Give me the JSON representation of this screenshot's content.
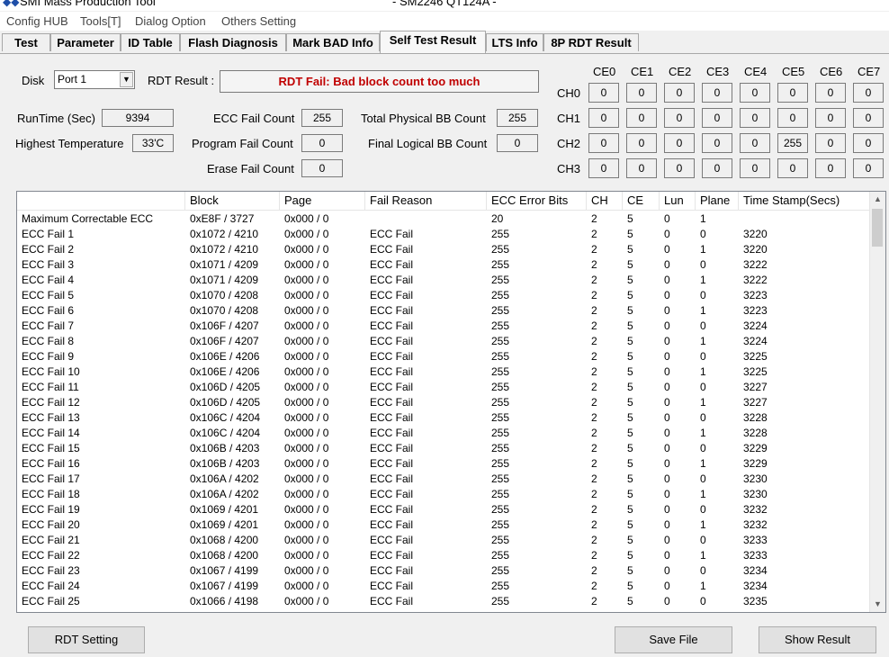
{
  "window": {
    "title_left": "SMI Mass Production Tool",
    "title_right": "- SM2246 QT124A -"
  },
  "menu": [
    "Config HUB",
    "Tools[T]",
    "Dialog Option",
    "Others Setting"
  ],
  "tabs": [
    "Test",
    "Parameter",
    "ID Table",
    "Flash Diagnosis",
    "Mark BAD Info",
    "Self Test Result",
    "LTS Info",
    "8P RDT Result"
  ],
  "active_tab": "Self Test Result",
  "disk": {
    "label": "Disk",
    "selected": "Port 1"
  },
  "rdt_result": {
    "label": "RDT Result :",
    "value": "RDT Fail:  Bad block count too much",
    "color": "#c00000"
  },
  "stats": {
    "runtime_label": "RunTime (Sec)",
    "runtime_value": "9394",
    "temp_label": "Highest Temperature",
    "temp_value": "33'C",
    "ecc_fail_label": "ECC Fail Count",
    "ecc_fail_value": "255",
    "program_fail_label": "Program Fail Count",
    "program_fail_value": "0",
    "erase_fail_label": "Erase Fail Count",
    "erase_fail_value": "0",
    "total_bb_label": "Total Physical BB Count",
    "total_bb_value": "255",
    "final_bb_label": "Final Logical BB Count",
    "final_bb_value": "0"
  },
  "grid": {
    "ce_headers": [
      "CE0",
      "CE1",
      "CE2",
      "CE3",
      "CE4",
      "CE5",
      "CE6",
      "CE7"
    ],
    "ch_headers": [
      "CH0",
      "CH1",
      "CH2",
      "CH3"
    ],
    "values": [
      [
        "0",
        "0",
        "0",
        "0",
        "0",
        "0",
        "0",
        "0"
      ],
      [
        "0",
        "0",
        "0",
        "0",
        "0",
        "0",
        "0",
        "0"
      ],
      [
        "0",
        "0",
        "0",
        "0",
        "0",
        "255",
        "0",
        "0"
      ],
      [
        "0",
        "0",
        "0",
        "0",
        "0",
        "0",
        "0",
        "0"
      ]
    ]
  },
  "table": {
    "columns": [
      "",
      "Block",
      "Page",
      "Fail Reason",
      "ECC Error Bits",
      "CH",
      "CE",
      "Lun",
      "Plane",
      "Time Stamp(Secs)"
    ],
    "rows": [
      [
        "Maximum Correctable ECC",
        "0xE8F / 3727",
        "0x000 / 0",
        "",
        "20",
        "2",
        "5",
        "0",
        "1",
        ""
      ],
      [
        "ECC Fail 1",
        "0x1072 / 4210",
        "0x000 / 0",
        "ECC Fail",
        "255",
        "2",
        "5",
        "0",
        "0",
        "3220"
      ],
      [
        "ECC Fail 2",
        "0x1072 / 4210",
        "0x000 / 0",
        "ECC Fail",
        "255",
        "2",
        "5",
        "0",
        "1",
        "3220"
      ],
      [
        "ECC Fail 3",
        "0x1071 / 4209",
        "0x000 / 0",
        "ECC Fail",
        "255",
        "2",
        "5",
        "0",
        "0",
        "3222"
      ],
      [
        "ECC Fail 4",
        "0x1071 / 4209",
        "0x000 / 0",
        "ECC Fail",
        "255",
        "2",
        "5",
        "0",
        "1",
        "3222"
      ],
      [
        "ECC Fail 5",
        "0x1070 / 4208",
        "0x000 / 0",
        "ECC Fail",
        "255",
        "2",
        "5",
        "0",
        "0",
        "3223"
      ],
      [
        "ECC Fail 6",
        "0x1070 / 4208",
        "0x000 / 0",
        "ECC Fail",
        "255",
        "2",
        "5",
        "0",
        "1",
        "3223"
      ],
      [
        "ECC Fail 7",
        "0x106F / 4207",
        "0x000 / 0",
        "ECC Fail",
        "255",
        "2",
        "5",
        "0",
        "0",
        "3224"
      ],
      [
        "ECC Fail 8",
        "0x106F / 4207",
        "0x000 / 0",
        "ECC Fail",
        "255",
        "2",
        "5",
        "0",
        "1",
        "3224"
      ],
      [
        "ECC Fail 9",
        "0x106E / 4206",
        "0x000 / 0",
        "ECC Fail",
        "255",
        "2",
        "5",
        "0",
        "0",
        "3225"
      ],
      [
        "ECC Fail 10",
        "0x106E / 4206",
        "0x000 / 0",
        "ECC Fail",
        "255",
        "2",
        "5",
        "0",
        "1",
        "3225"
      ],
      [
        "ECC Fail 11",
        "0x106D / 4205",
        "0x000 / 0",
        "ECC Fail",
        "255",
        "2",
        "5",
        "0",
        "0",
        "3227"
      ],
      [
        "ECC Fail 12",
        "0x106D / 4205",
        "0x000 / 0",
        "ECC Fail",
        "255",
        "2",
        "5",
        "0",
        "1",
        "3227"
      ],
      [
        "ECC Fail 13",
        "0x106C / 4204",
        "0x000 / 0",
        "ECC Fail",
        "255",
        "2",
        "5",
        "0",
        "0",
        "3228"
      ],
      [
        "ECC Fail 14",
        "0x106C / 4204",
        "0x000 / 0",
        "ECC Fail",
        "255",
        "2",
        "5",
        "0",
        "1",
        "3228"
      ],
      [
        "ECC Fail 15",
        "0x106B / 4203",
        "0x000 / 0",
        "ECC Fail",
        "255",
        "2",
        "5",
        "0",
        "0",
        "3229"
      ],
      [
        "ECC Fail 16",
        "0x106B / 4203",
        "0x000 / 0",
        "ECC Fail",
        "255",
        "2",
        "5",
        "0",
        "1",
        "3229"
      ],
      [
        "ECC Fail 17",
        "0x106A / 4202",
        "0x000 / 0",
        "ECC Fail",
        "255",
        "2",
        "5",
        "0",
        "0",
        "3230"
      ],
      [
        "ECC Fail 18",
        "0x106A / 4202",
        "0x000 / 0",
        "ECC Fail",
        "255",
        "2",
        "5",
        "0",
        "1",
        "3230"
      ],
      [
        "ECC Fail 19",
        "0x1069 / 4201",
        "0x000 / 0",
        "ECC Fail",
        "255",
        "2",
        "5",
        "0",
        "0",
        "3232"
      ],
      [
        "ECC Fail 20",
        "0x1069 / 4201",
        "0x000 / 0",
        "ECC Fail",
        "255",
        "2",
        "5",
        "0",
        "1",
        "3232"
      ],
      [
        "ECC Fail 21",
        "0x1068 / 4200",
        "0x000 / 0",
        "ECC Fail",
        "255",
        "2",
        "5",
        "0",
        "0",
        "3233"
      ],
      [
        "ECC Fail 22",
        "0x1068 / 4200",
        "0x000 / 0",
        "ECC Fail",
        "255",
        "2",
        "5",
        "0",
        "1",
        "3233"
      ],
      [
        "ECC Fail 23",
        "0x1067 / 4199",
        "0x000 / 0",
        "ECC Fail",
        "255",
        "2",
        "5",
        "0",
        "0",
        "3234"
      ],
      [
        "ECC Fail 24",
        "0x1067 / 4199",
        "0x000 / 0",
        "ECC Fail",
        "255",
        "2",
        "5",
        "0",
        "1",
        "3234"
      ],
      [
        "ECC Fail 25",
        "0x1066 / 4198",
        "0x000 / 0",
        "ECC Fail",
        "255",
        "2",
        "5",
        "0",
        "0",
        "3235"
      ]
    ]
  },
  "buttons": {
    "rdt_setting": "RDT Setting",
    "save_file": "Save File",
    "show_result": "Show Result"
  }
}
